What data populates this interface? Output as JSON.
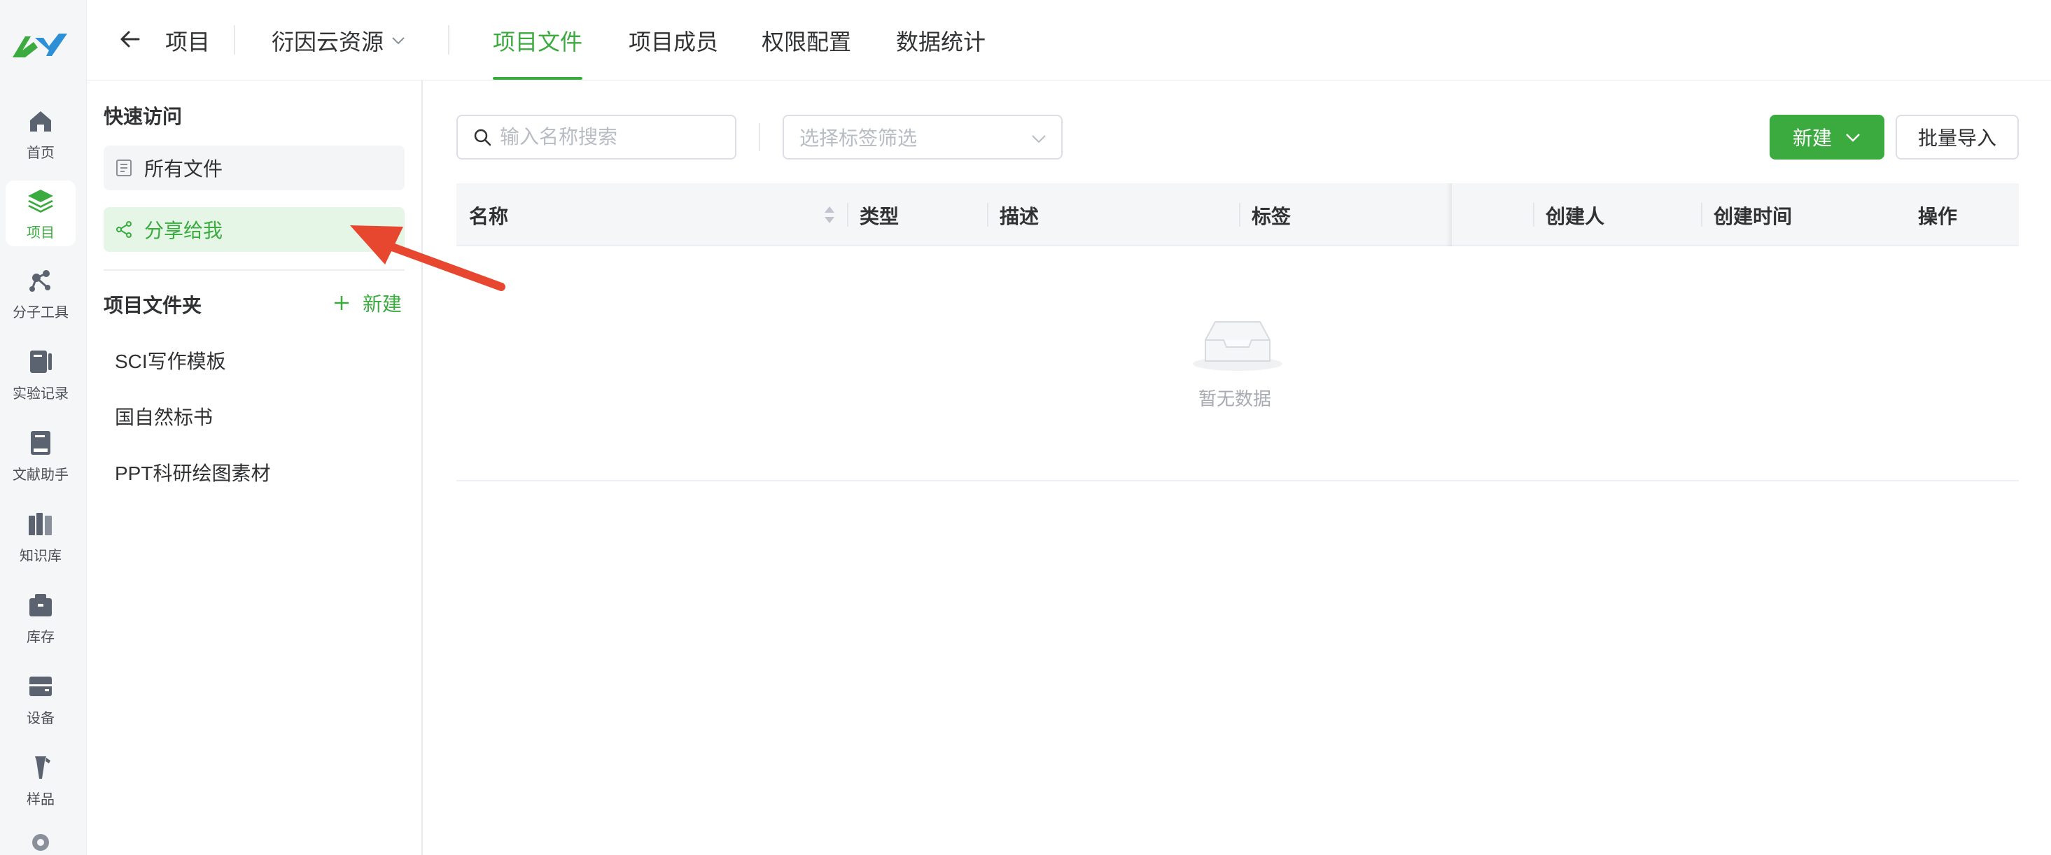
{
  "rail": {
    "items": [
      {
        "label": "首页",
        "icon": "home-icon"
      },
      {
        "label": "项目",
        "icon": "layers-icon",
        "active": true
      },
      {
        "label": "分子工具",
        "icon": "molecule-icon"
      },
      {
        "label": "实验记录",
        "icon": "notebook-icon"
      },
      {
        "label": "文献助手",
        "icon": "book-icon"
      },
      {
        "label": "知识库",
        "icon": "library-icon"
      },
      {
        "label": "库存",
        "icon": "inventory-icon"
      },
      {
        "label": "设备",
        "icon": "device-icon"
      },
      {
        "label": "样品",
        "icon": "sample-icon"
      }
    ]
  },
  "header": {
    "back_label": "项目",
    "project_name": "衍因云资源",
    "tabs": [
      {
        "label": "项目文件",
        "active": true
      },
      {
        "label": "项目成员"
      },
      {
        "label": "权限配置"
      },
      {
        "label": "数据统计"
      }
    ]
  },
  "side": {
    "quick_title": "快速访问",
    "quick_items": [
      {
        "label": "所有文件",
        "icon": "document-icon"
      },
      {
        "label": "分享给我",
        "icon": "share-icon",
        "active": true
      }
    ],
    "folders_title": "项目文件夹",
    "new_folder_label": "新建",
    "folders": [
      "SCI写作模板",
      "国自然标书",
      "PPT科研绘图素材"
    ]
  },
  "toolbar": {
    "search_placeholder": "输入名称搜索",
    "tag_placeholder": "选择标签筛选",
    "new_label": "新建",
    "import_label": "批量导入"
  },
  "table": {
    "columns": [
      "名称",
      "类型",
      "描述",
      "标签",
      "创建人",
      "创建时间",
      "操作"
    ],
    "rows": [],
    "empty_text": "暂无数据"
  },
  "colors": {
    "accent": "#3bab3f",
    "accent_light": "#e5f6e7",
    "annotation_arrow": "#e8472f"
  }
}
